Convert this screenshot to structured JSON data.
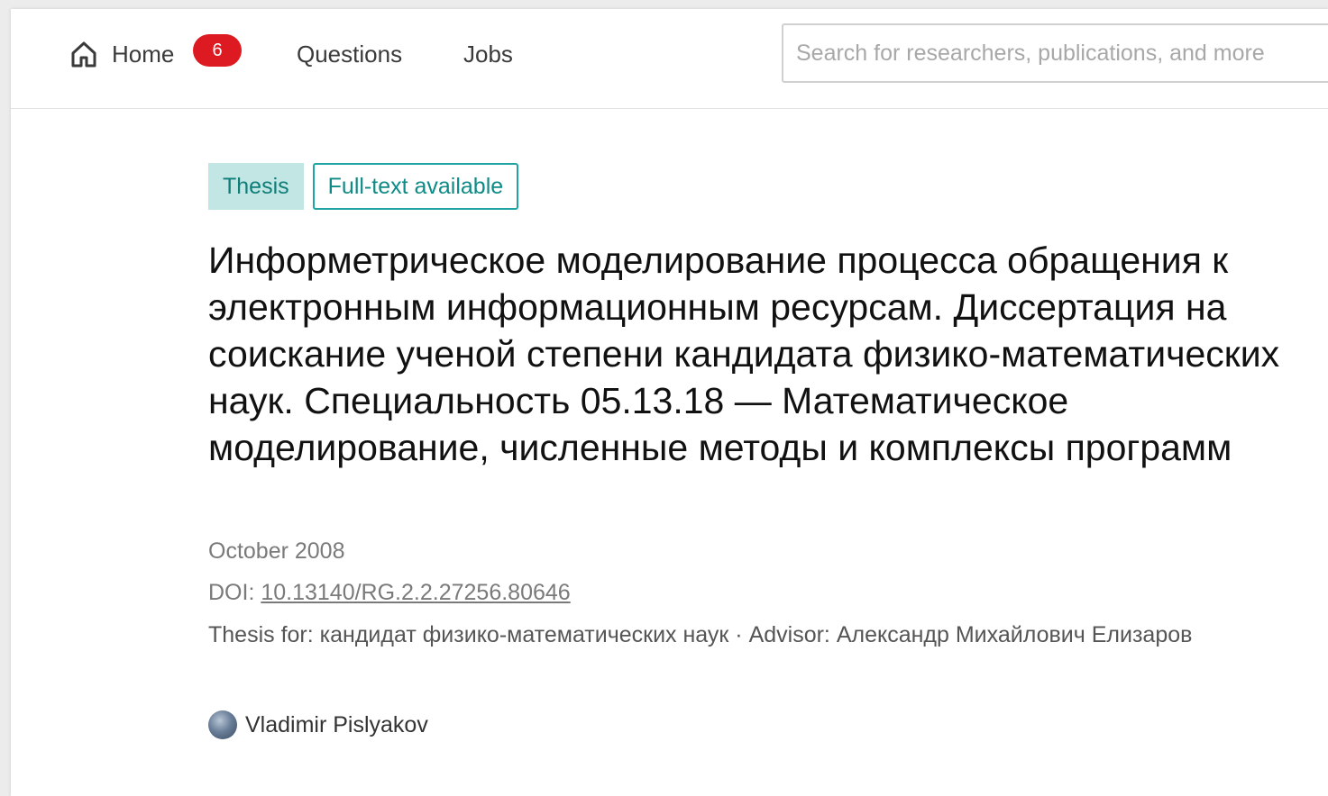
{
  "nav": {
    "home_label": "Home",
    "home_badge": "6",
    "questions_label": "Questions",
    "jobs_label": "Jobs",
    "search_placeholder": "Search for researchers, publications, and more"
  },
  "publication": {
    "tags": {
      "type": "Thesis",
      "fulltext": "Full-text available"
    },
    "title": "Информетрическое моделирование процесса обращения к электронным информационным ресурсам. Диссертация на соискание ученой степени кандидата физико-математических наук. Специальность 05.13.18 — Математическое моделирование, численные методы и комплексы программ",
    "date": "October 2008",
    "doi_label": "DOI: ",
    "doi_value": "10.13140/RG.2.2.27256.80646",
    "thesis_info": "Thesis for: кандидат физико-математических наук · Advisor: Александр Михайлович Елизаров",
    "author_name": "Vladimir Pislyakov"
  },
  "colors": {
    "badge": "#dd1a21",
    "tag_bg": "#c2e6e3",
    "tag_text": "#0f7d79",
    "tag_border": "#1fa3a3"
  },
  "icons": {
    "home": "home-icon",
    "avatar": "author-avatar"
  }
}
